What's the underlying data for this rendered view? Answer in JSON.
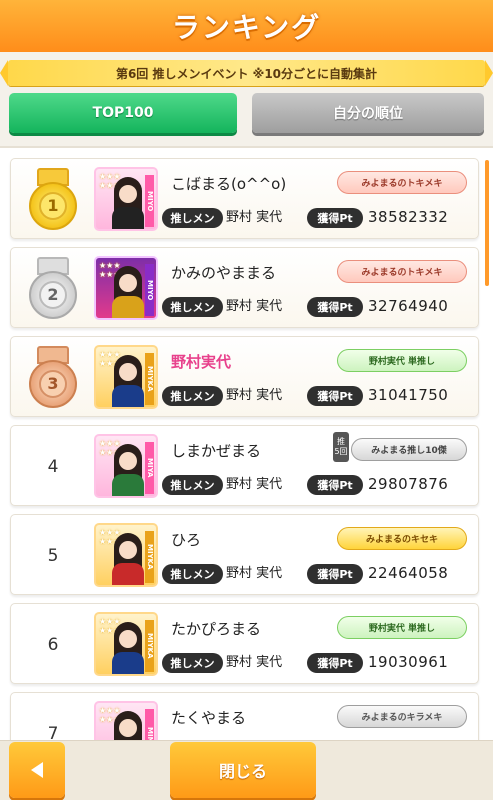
{
  "header": {
    "title": "ランキング"
  },
  "event": {
    "text": "第6回 推しメンイベント ※10分ごとに自動集計"
  },
  "tabs": {
    "top100": "TOP100",
    "self": "自分の順位"
  },
  "labels": {
    "oshi": "推しメン",
    "pt": "獲得Pt"
  },
  "rows": [
    {
      "rank": "1",
      "medal": "gold",
      "name": "こばまる(o^^o)",
      "oshi_name": "野村 実代",
      "points": "38582332",
      "badge": "みよまるのトキメキ",
      "side": "MIYO",
      "border": "#ffc3e6"
    },
    {
      "rank": "2",
      "medal": "silver",
      "name": "かみのやままる",
      "oshi_name": "野村 実代",
      "points": "32764940",
      "badge": "みよまるのトキメキ",
      "side": "MIYO",
      "border": "#f2c4ff"
    },
    {
      "rank": "3",
      "medal": "bronze",
      "name": "野村実代",
      "oshi_name": "野村 実代",
      "points": "31041750",
      "badge": "野村実代 単推し",
      "side": "MIYKA",
      "border": "#ffd88a"
    },
    {
      "rank": "4",
      "medal": "",
      "name": "しまかぜまる",
      "oshi_name": "野村 実代",
      "points": "29807876",
      "badge": "みよまる推し10傑",
      "side": "MIYA",
      "border": "#ffc3e6",
      "tag_top": "推",
      "tag_bottom": "5回"
    },
    {
      "rank": "5",
      "medal": "",
      "name": "ひろ",
      "oshi_name": "野村 実代",
      "points": "22464058",
      "badge": "みよまるのキセキ",
      "side": "MIYKA",
      "border": "#ffd88a"
    },
    {
      "rank": "6",
      "medal": "",
      "name": "たかぴろまる",
      "oshi_name": "野村 実代",
      "points": "19030961",
      "badge": "野村実代 単推し",
      "side": "MIYKA",
      "border": "#ffd88a"
    },
    {
      "rank": "7",
      "medal": "",
      "name": "たくやまる",
      "oshi_name": "",
      "points": "",
      "badge": "みよまるのキラメキ",
      "side": "MIN",
      "border": "#ffc3e6"
    }
  ],
  "footer": {
    "close_label": "閉じる"
  },
  "icons": {
    "back": "arrow-left-icon",
    "medal": "medal-icon"
  },
  "colors": {
    "accent": "#ff9a17",
    "pink_name": "#e8418c",
    "tab_active": "#14b45c"
  }
}
